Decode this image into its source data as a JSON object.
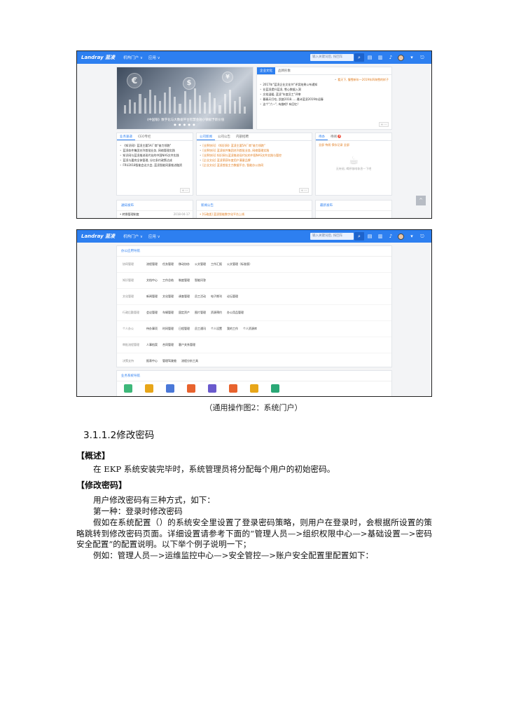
{
  "screenshot1": {
    "logo": "Landray 蓝凌",
    "nav": [
      "机构门户 ∨",
      "应用 ∨"
    ],
    "search_placeholder": "输入关键词后, 按回车",
    "banner_caption": "《中国银》数字化与大数据平台智慧金融小镇赋予新价值",
    "banner_dots": "● ● ● ● ●",
    "news_tabs": [
      "企业文化",
      "品牌形象"
    ],
    "news_items": [
      "看天下, 慢雪新年一2019年四海雪的样子",
      "2017年\"蓝凌企业文化节\"评奖结果公布通知",
      "业蓝凌提升蓝凌, 雪心数据入洞",
      "文档温暖, 蓝凌\"年度员工\"评审",
      "暮春天打吃, 凯旋2018......雅诗蓝凌2019年迎春",
      "这个\"六一\", 有趣吧! 有回忆!"
    ],
    "col1_tabs": [
      "业务速递",
      "CEO专栏"
    ],
    "col1_items": [
      "《知识网》蓝凌主要5A厂商\"奋力领跑\"",
      "蓝凌软件集团名列首批业务, 网络管理实践",
      "知识网与蓝凌推进现代化的中国NAS文件实践",
      "蓝凌与嘉宾全体管理, 分红条约政策达成",
      "FRU2018智能会议大会, 蓝凌智能同意推进融资"
    ],
    "col2_tabs": [
      "公司新闻",
      "公司公告",
      "内部招聘"
    ],
    "col2_items": [
      "[业界快讯] 《知识网》蓝凌主要5A厂商\"奋力领跑\"",
      "[业界快讯] 蓝凌软件集团名列首批业务, 网络管理实践",
      "[业界快讯] 知识网与蓝凌推进现代化的中国NAS文件实践与管控",
      "[企业文化] 蓝凌荣获年度用户满意品牌",
      "[企业文化] 蓝凌首批主力数据平台, 智能办公协同"
    ],
    "col3_tabs": [
      "待办",
      "待阅"
    ],
    "col3_badge": "8",
    "col3_filter": "全部 待阅 保存记录 全部",
    "col3_empty": "无待阅, 喝杯咖啡休息一下吧",
    "more_label": "+  ···",
    "bottom_panels": [
      "通知发布",
      "新闻公告",
      "最新发布"
    ],
    "bottom_item1": "• 转换管理制度",
    "bottom_date": "2018-04-17",
    "bottom_item2": "• [行政类] 蓝凌智能数字化平台上线"
  },
  "screenshot2": {
    "logo": "Landray 蓝凌",
    "nav": [
      "机构门户 ∨",
      "应用 ∨"
    ],
    "search_placeholder": "输入关键词后, 按回车",
    "panel_title": "办公应用导航",
    "groups": [
      {
        "cat": "协同管理",
        "items": [
          "流程管理",
          "任务管理",
          "移动协办",
          "公文管理",
          "工作汇报",
          "公文管理（标准版）"
        ]
      },
      {
        "cat": "知识管理",
        "items": [
          "文档中心",
          "工作总结",
          "制度管理",
          "智能问答"
        ]
      },
      {
        "cat": "文化管理",
        "items": [
          "新闻管理",
          "文化管理",
          "调查管理",
          "员工活动",
          "电子期刊",
          "论坛管理"
        ]
      },
      {
        "cat": "行政后勤管理",
        "items": [
          "会议管理",
          "车辆管理",
          "固定资产",
          "图片管理",
          "资源预约",
          "办公用品管理"
        ]
      },
      {
        "cat": "个人办公",
        "items": [
          "待办事项",
          "时间管理",
          "日程管理",
          "员工通讯",
          "个人设置",
          "我的工作",
          "个人资源库"
        ]
      },
      {
        "cat": "审批流程管理",
        "items": [
          "人事档案",
          "合同管理",
          "客户关系管理"
        ]
      },
      {
        "cat": "决策支持",
        "items": [
          "报表中心",
          "管理驾驶舱",
          "流程分析工具"
        ]
      }
    ],
    "bottom_title": "业务系统导航",
    "icon_colors": [
      "#3eb87a",
      "#e8a619",
      "#4a78d8",
      "#e8632e",
      "#6a5acd",
      "#e8632e",
      "#e8a619",
      "#2aa876"
    ]
  },
  "figure_caption": "（通用操作图2：系统门户）",
  "section_heading": "3.1.1.2修改密码",
  "overview_head": "【概述】",
  "overview_text": "在 EKP 系统安装完毕时，系统管理员将分配每个用户的初始密码。",
  "change_head": "【修改密码】",
  "change_intro": "用户修改密码有三种方式，如下：",
  "method1": "第一种：登录时修改密码",
  "method1_desc": "假如在系统配置（）的系统安全里设置了登录密码策略，则用户在登录时，会根据所设置的策略跳转到修改密码页面。详细设置请参考下面的“管理人员—>组织权限中心—>基础设置—>密码安全配置”的配置说明。以下举个例子说明一下；",
  "example": "例如：管理人员—>运维监控中心—>安全管控—>账户安全配置里配置如下："
}
